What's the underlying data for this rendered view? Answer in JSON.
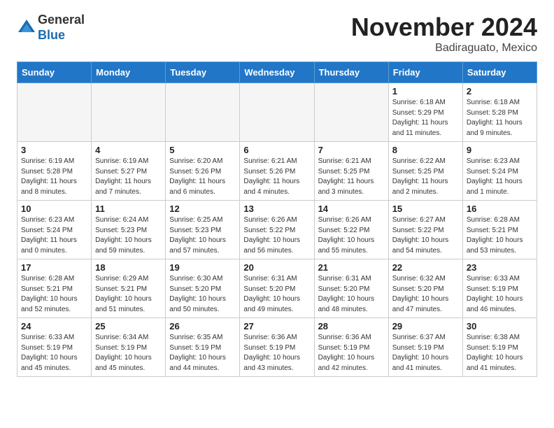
{
  "header": {
    "logo_general": "General",
    "logo_blue": "Blue",
    "month_title": "November 2024",
    "location": "Badiraguato, Mexico"
  },
  "weekdays": [
    "Sunday",
    "Monday",
    "Tuesday",
    "Wednesday",
    "Thursday",
    "Friday",
    "Saturday"
  ],
  "weeks": [
    [
      {
        "day": "",
        "info": ""
      },
      {
        "day": "",
        "info": ""
      },
      {
        "day": "",
        "info": ""
      },
      {
        "day": "",
        "info": ""
      },
      {
        "day": "",
        "info": ""
      },
      {
        "day": "1",
        "info": "Sunrise: 6:18 AM\nSunset: 5:29 PM\nDaylight: 11 hours and 11 minutes."
      },
      {
        "day": "2",
        "info": "Sunrise: 6:18 AM\nSunset: 5:28 PM\nDaylight: 11 hours and 9 minutes."
      }
    ],
    [
      {
        "day": "3",
        "info": "Sunrise: 6:19 AM\nSunset: 5:28 PM\nDaylight: 11 hours and 8 minutes."
      },
      {
        "day": "4",
        "info": "Sunrise: 6:19 AM\nSunset: 5:27 PM\nDaylight: 11 hours and 7 minutes."
      },
      {
        "day": "5",
        "info": "Sunrise: 6:20 AM\nSunset: 5:26 PM\nDaylight: 11 hours and 6 minutes."
      },
      {
        "day": "6",
        "info": "Sunrise: 6:21 AM\nSunset: 5:26 PM\nDaylight: 11 hours and 4 minutes."
      },
      {
        "day": "7",
        "info": "Sunrise: 6:21 AM\nSunset: 5:25 PM\nDaylight: 11 hours and 3 minutes."
      },
      {
        "day": "8",
        "info": "Sunrise: 6:22 AM\nSunset: 5:25 PM\nDaylight: 11 hours and 2 minutes."
      },
      {
        "day": "9",
        "info": "Sunrise: 6:23 AM\nSunset: 5:24 PM\nDaylight: 11 hours and 1 minute."
      }
    ],
    [
      {
        "day": "10",
        "info": "Sunrise: 6:23 AM\nSunset: 5:24 PM\nDaylight: 11 hours and 0 minutes."
      },
      {
        "day": "11",
        "info": "Sunrise: 6:24 AM\nSunset: 5:23 PM\nDaylight: 10 hours and 59 minutes."
      },
      {
        "day": "12",
        "info": "Sunrise: 6:25 AM\nSunset: 5:23 PM\nDaylight: 10 hours and 57 minutes."
      },
      {
        "day": "13",
        "info": "Sunrise: 6:26 AM\nSunset: 5:22 PM\nDaylight: 10 hours and 56 minutes."
      },
      {
        "day": "14",
        "info": "Sunrise: 6:26 AM\nSunset: 5:22 PM\nDaylight: 10 hours and 55 minutes."
      },
      {
        "day": "15",
        "info": "Sunrise: 6:27 AM\nSunset: 5:22 PM\nDaylight: 10 hours and 54 minutes."
      },
      {
        "day": "16",
        "info": "Sunrise: 6:28 AM\nSunset: 5:21 PM\nDaylight: 10 hours and 53 minutes."
      }
    ],
    [
      {
        "day": "17",
        "info": "Sunrise: 6:28 AM\nSunset: 5:21 PM\nDaylight: 10 hours and 52 minutes."
      },
      {
        "day": "18",
        "info": "Sunrise: 6:29 AM\nSunset: 5:21 PM\nDaylight: 10 hours and 51 minutes."
      },
      {
        "day": "19",
        "info": "Sunrise: 6:30 AM\nSunset: 5:20 PM\nDaylight: 10 hours and 50 minutes."
      },
      {
        "day": "20",
        "info": "Sunrise: 6:31 AM\nSunset: 5:20 PM\nDaylight: 10 hours and 49 minutes."
      },
      {
        "day": "21",
        "info": "Sunrise: 6:31 AM\nSunset: 5:20 PM\nDaylight: 10 hours and 48 minutes."
      },
      {
        "day": "22",
        "info": "Sunrise: 6:32 AM\nSunset: 5:20 PM\nDaylight: 10 hours and 47 minutes."
      },
      {
        "day": "23",
        "info": "Sunrise: 6:33 AM\nSunset: 5:19 PM\nDaylight: 10 hours and 46 minutes."
      }
    ],
    [
      {
        "day": "24",
        "info": "Sunrise: 6:33 AM\nSunset: 5:19 PM\nDaylight: 10 hours and 45 minutes."
      },
      {
        "day": "25",
        "info": "Sunrise: 6:34 AM\nSunset: 5:19 PM\nDaylight: 10 hours and 45 minutes."
      },
      {
        "day": "26",
        "info": "Sunrise: 6:35 AM\nSunset: 5:19 PM\nDaylight: 10 hours and 44 minutes."
      },
      {
        "day": "27",
        "info": "Sunrise: 6:36 AM\nSunset: 5:19 PM\nDaylight: 10 hours and 43 minutes."
      },
      {
        "day": "28",
        "info": "Sunrise: 6:36 AM\nSunset: 5:19 PM\nDaylight: 10 hours and 42 minutes."
      },
      {
        "day": "29",
        "info": "Sunrise: 6:37 AM\nSunset: 5:19 PM\nDaylight: 10 hours and 41 minutes."
      },
      {
        "day": "30",
        "info": "Sunrise: 6:38 AM\nSunset: 5:19 PM\nDaylight: 10 hours and 41 minutes."
      }
    ]
  ]
}
